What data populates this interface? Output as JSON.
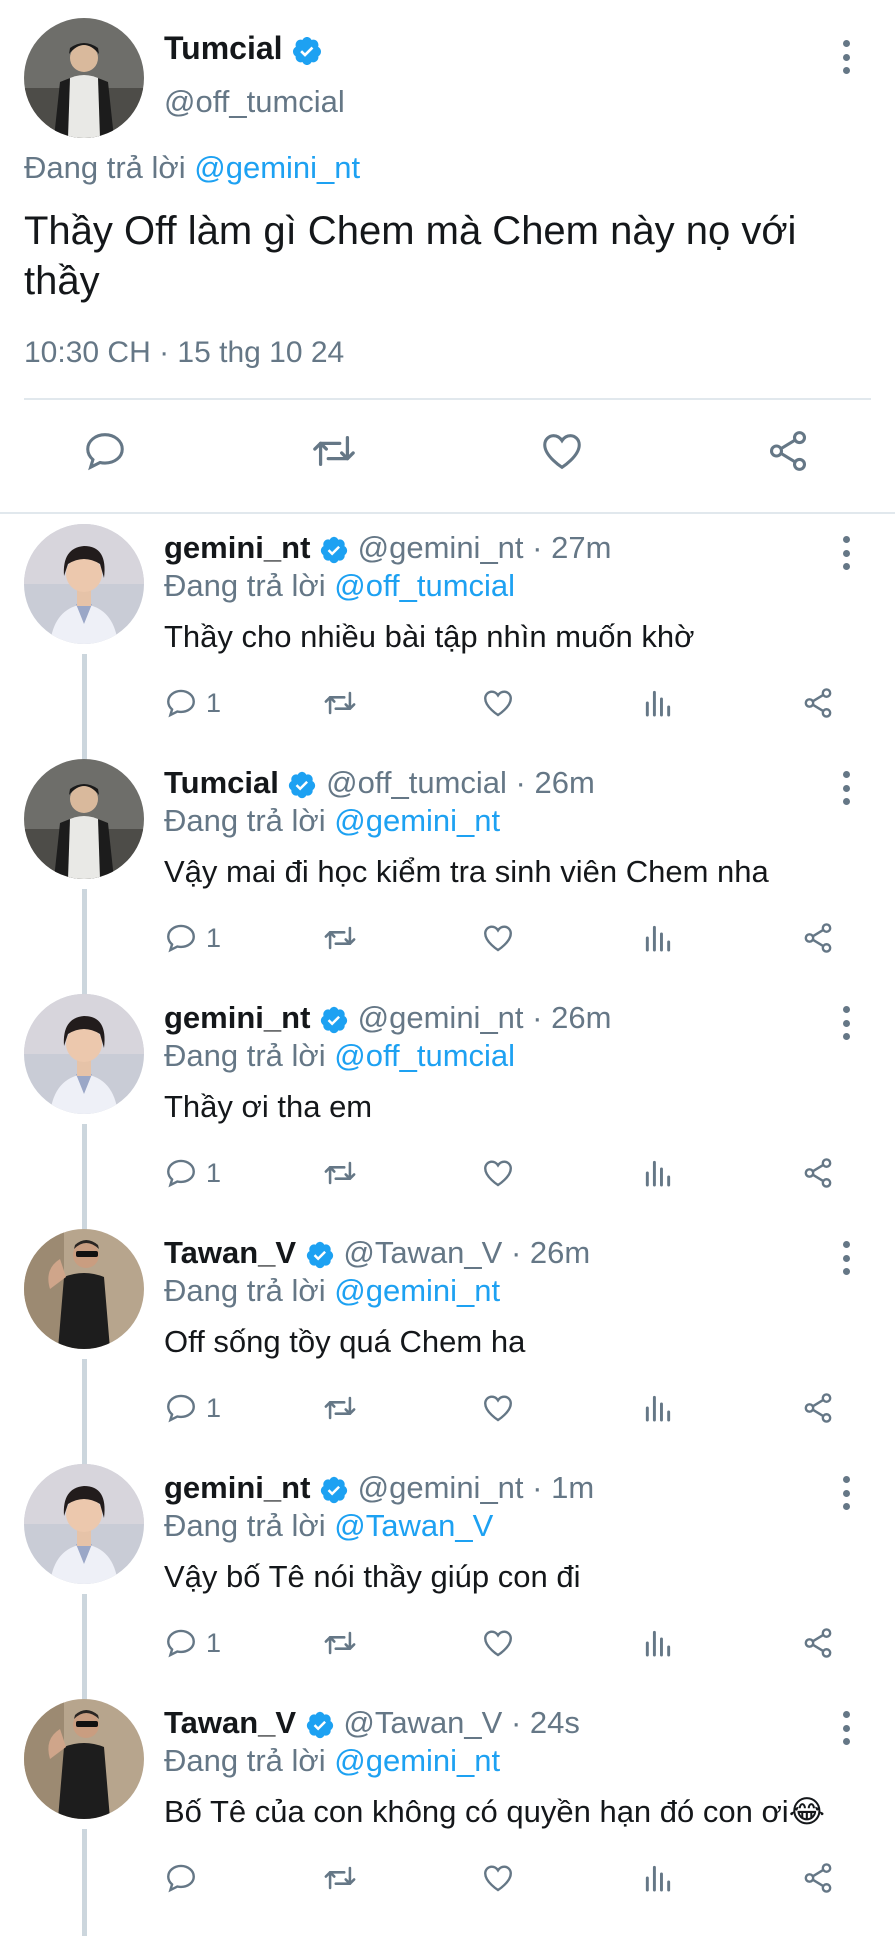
{
  "colors": {
    "accent": "#1da1f2",
    "muted": "#657786",
    "text": "#14171a",
    "divider": "#e1e8ed"
  },
  "main_tweet": {
    "name": "Tumcial",
    "handle": "@off_tumcial",
    "replying_prefix": "Đang trả lời",
    "replying_to": "@gemini_nt",
    "text": "Thầy Off làm gì Chem mà Chem này nọ với thầy",
    "timestamp": "10:30 CH · 15 thg 10 24",
    "actions": [
      "reply-icon",
      "retweet-icon",
      "like-icon",
      "share-icon"
    ]
  },
  "replies": [
    {
      "name": "gemini_nt",
      "handle": "@gemini_nt",
      "time": "· 27m",
      "replying_prefix": "Đang trả lời",
      "replying_to": "@off_tumcial",
      "text": "Thầy cho nhiều bài tập nhìn muốn khờ",
      "reply_count": "1",
      "avatar": "gemini"
    },
    {
      "name": "Tumcial",
      "handle": "@off_tumcial",
      "time": "· 26m",
      "replying_prefix": "Đang trả lời",
      "replying_to": "@gemini_nt",
      "text": "Vậy mai đi học kiểm tra sinh viên Chem nha",
      "reply_count": "1",
      "avatar": "tumcial"
    },
    {
      "name": "gemini_nt",
      "handle": "@gemini_nt",
      "time": "· 26m",
      "replying_prefix": "Đang trả lời",
      "replying_to": "@off_tumcial",
      "text": "Thầy ơi tha em",
      "reply_count": "1",
      "avatar": "gemini"
    },
    {
      "name": "Tawan_V",
      "handle": "@Tawan_V",
      "time": "· 26m",
      "replying_prefix": "Đang trả lời",
      "replying_to": "@gemini_nt",
      "text": "Off sống tồy quá Chem ha",
      "reply_count": "1",
      "avatar": "tawan"
    },
    {
      "name": "gemini_nt",
      "handle": "@gemini_nt",
      "time": "· 1m",
      "replying_prefix": "Đang trả lời",
      "replying_to": "@Tawan_V",
      "text": "Vậy bố Tê nói thầy giúp con đi",
      "reply_count": "1",
      "avatar": "gemini"
    },
    {
      "name": "Tawan_V",
      "handle": "@Tawan_V",
      "time": "· 24s",
      "replying_prefix": "Đang trả lời",
      "replying_to": "@gemini_nt",
      "text": "Bố Tê của con không có quyền hạn đó con ơi😂",
      "reply_count": "",
      "avatar": "tawan"
    }
  ]
}
